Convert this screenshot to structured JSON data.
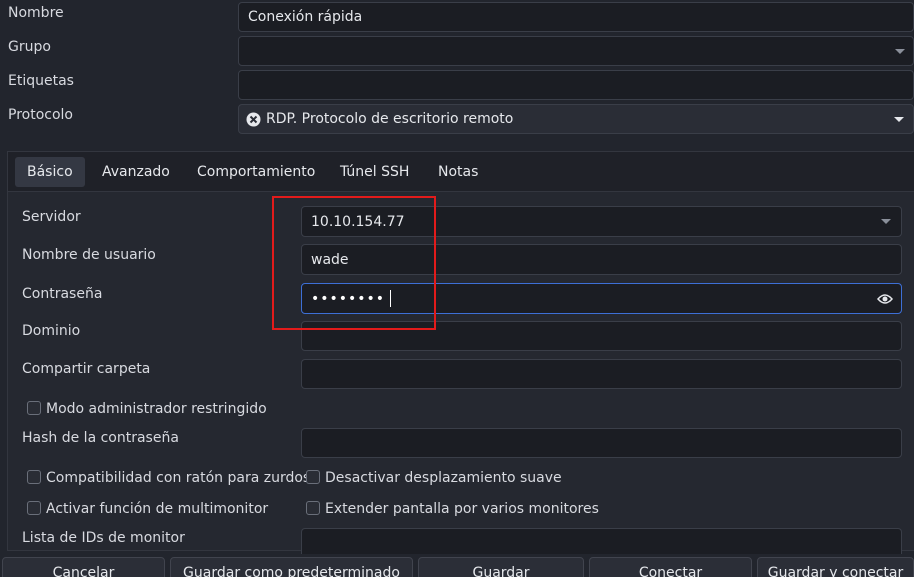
{
  "top_form": {
    "nombre_label": "Nombre",
    "nombre_value": "Conexión rápida",
    "grupo_label": "Grupo",
    "grupo_value": "",
    "etiquetas_label": "Etiquetas",
    "etiquetas_value": "",
    "protocolo_label": "Protocolo",
    "protocolo_value": "RDP. Protocolo de escritorio remoto"
  },
  "tabs": [
    {
      "label": "Básico"
    },
    {
      "label": "Avanzado"
    },
    {
      "label": "Comportamiento"
    },
    {
      "label": "Túnel SSH"
    },
    {
      "label": "Notas"
    }
  ],
  "basic": {
    "servidor_label": "Servidor",
    "servidor_value": "10.10.154.77",
    "usuario_label": "Nombre de usuario",
    "usuario_value": "wade",
    "contrasena_label": "Contraseña",
    "contrasena_value": "••••••••",
    "dominio_label": "Dominio",
    "compartir_label": "Compartir carpeta",
    "modo_admin_label": "Modo administrador restringido",
    "hash_label": "Hash de la contraseña",
    "zurdos_label": "Compatibilidad con ratón para zurdos",
    "desplazamiento_label": "Desactivar desplazamiento suave",
    "multimonitor_label": "Activar función de multimonitor",
    "extender_label": "Extender pantalla por varios monitores",
    "lista_ids_label": "Lista de IDs de monitor"
  },
  "buttons": {
    "cancelar": "Cancelar",
    "guardar_predeterminado": "Guardar como predeterminado",
    "guardar": "Guardar",
    "conectar": "Conectar",
    "guardar_conectar": "Guardar y conectar"
  },
  "colors": {
    "background": "#22252d",
    "focus_border": "#3d6fd6",
    "annotation_red": "#e21b1b"
  },
  "icons": {
    "protocol": "rdp-plugin-icon",
    "reveal_password": "eye-icon"
  }
}
